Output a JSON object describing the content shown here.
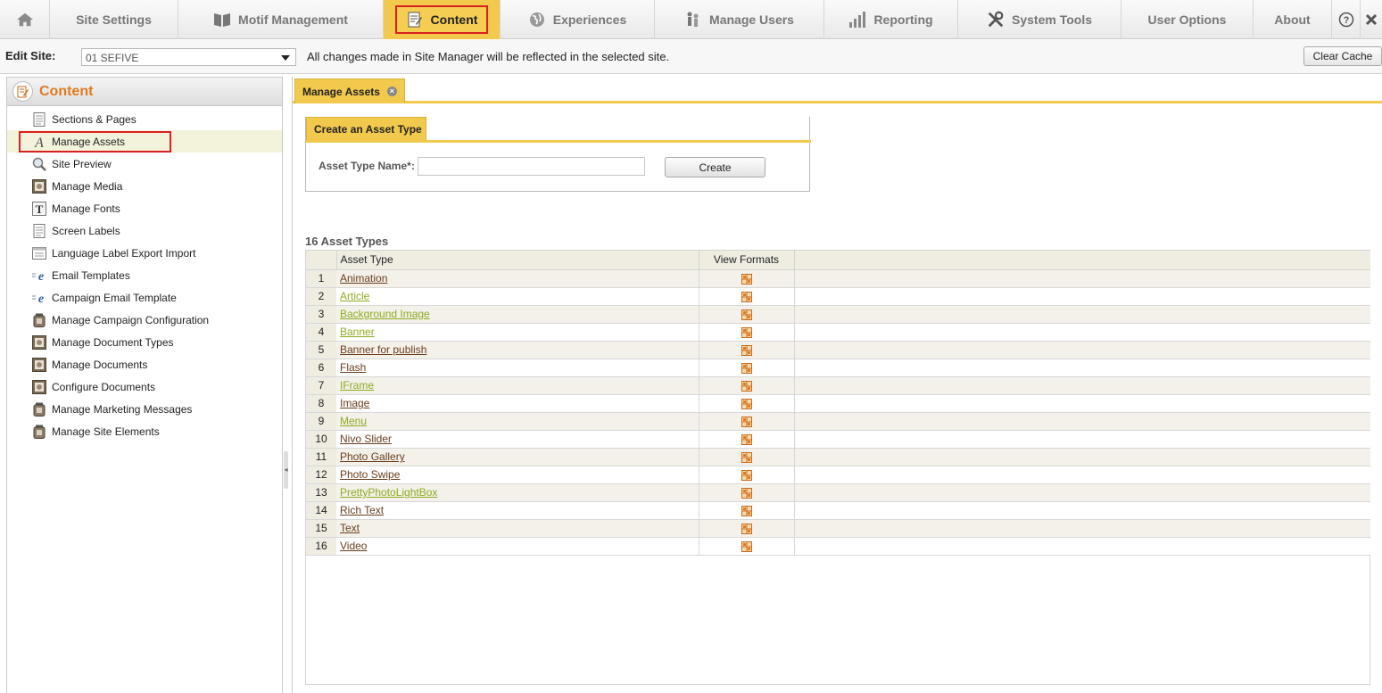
{
  "nav": {
    "items": [
      {
        "label": "",
        "icon": "home-icon"
      },
      {
        "label": "Site Settings",
        "icon": ""
      },
      {
        "label": "Motif Management",
        "icon": "book-icon"
      },
      {
        "label": "Content",
        "icon": "edit-icon",
        "active": true
      },
      {
        "label": "Experiences",
        "icon": "globe-icon"
      },
      {
        "label": "Manage Users",
        "icon": "users-icon"
      },
      {
        "label": "Reporting",
        "icon": "bar-chart-icon"
      },
      {
        "label": "System Tools",
        "icon": "tools-icon"
      },
      {
        "label": "User Options",
        "icon": ""
      },
      {
        "label": "About",
        "icon": ""
      }
    ],
    "help_icon": "help-icon",
    "close_icon": "close-icon"
  },
  "edit_site": {
    "label": "Edit Site:",
    "selected": "01 SEFIVE",
    "message": "All changes made in Site Manager will be reflected in the selected site.",
    "clear_cache": "Clear Cache"
  },
  "sidebar": {
    "title": "Content",
    "items": [
      {
        "label": "Sections & Pages",
        "icon": "page-icon"
      },
      {
        "label": "Manage Assets",
        "icon": "asset-icon",
        "selected": true
      },
      {
        "label": "Site Preview",
        "icon": "magnifier-icon"
      },
      {
        "label": "Manage Media",
        "icon": "media-icon"
      },
      {
        "label": "Manage Fonts",
        "icon": "font-icon"
      },
      {
        "label": "Screen Labels",
        "icon": "page-icon"
      },
      {
        "label": "Language Label Export Import",
        "icon": "doc-icon"
      },
      {
        "label": "Email Templates",
        "icon": "email-icon"
      },
      {
        "label": "Campaign Email Template",
        "icon": "email-icon"
      },
      {
        "label": "Manage Campaign Configuration",
        "icon": "jar-icon"
      },
      {
        "label": "Manage Document Types",
        "icon": "media-icon"
      },
      {
        "label": "Manage Documents",
        "icon": "media-icon"
      },
      {
        "label": "Configure Documents",
        "icon": "media-icon"
      },
      {
        "label": "Manage Marketing Messages",
        "icon": "jar-icon"
      },
      {
        "label": "Manage Site Elements",
        "icon": "jar-icon"
      }
    ]
  },
  "main": {
    "tab_label": "Manage Assets",
    "create": {
      "tab_label": "Create an Asset Type",
      "field_label": "Asset Type Name*:",
      "field_value": "",
      "button": "Create"
    },
    "count_label": "16 Asset Types",
    "columns": [
      "Asset Type",
      "View Formats"
    ],
    "rows": [
      {
        "num": "1",
        "name": "Animation",
        "style": "brown"
      },
      {
        "num": "2",
        "name": "Article",
        "style": "green"
      },
      {
        "num": "3",
        "name": "Background Image",
        "style": "green"
      },
      {
        "num": "4",
        "name": "Banner",
        "style": "green"
      },
      {
        "num": "5",
        "name": "Banner for publish",
        "style": "brown"
      },
      {
        "num": "6",
        "name": "Flash",
        "style": "brown"
      },
      {
        "num": "7",
        "name": "IFrame",
        "style": "green"
      },
      {
        "num": "8",
        "name": "Image",
        "style": "brown"
      },
      {
        "num": "9",
        "name": "Menu",
        "style": "green"
      },
      {
        "num": "10",
        "name": "Nivo Slider",
        "style": "brown"
      },
      {
        "num": "11",
        "name": "Photo Gallery",
        "style": "brown"
      },
      {
        "num": "12",
        "name": "Photo Swipe",
        "style": "brown"
      },
      {
        "num": "13",
        "name": "PrettyPhotoLightBox",
        "style": "green"
      },
      {
        "num": "14",
        "name": "Rich Text",
        "style": "brown"
      },
      {
        "num": "15",
        "name": "Text",
        "style": "brown"
      },
      {
        "num": "16",
        "name": "Video",
        "style": "brown"
      }
    ]
  },
  "colors": {
    "accent": "#f2c94c",
    "highlight_border": "#d8201f",
    "sidebar_title": "#e07a1f",
    "link_brown": "#6a3d1d",
    "link_green": "#8faa1f"
  }
}
